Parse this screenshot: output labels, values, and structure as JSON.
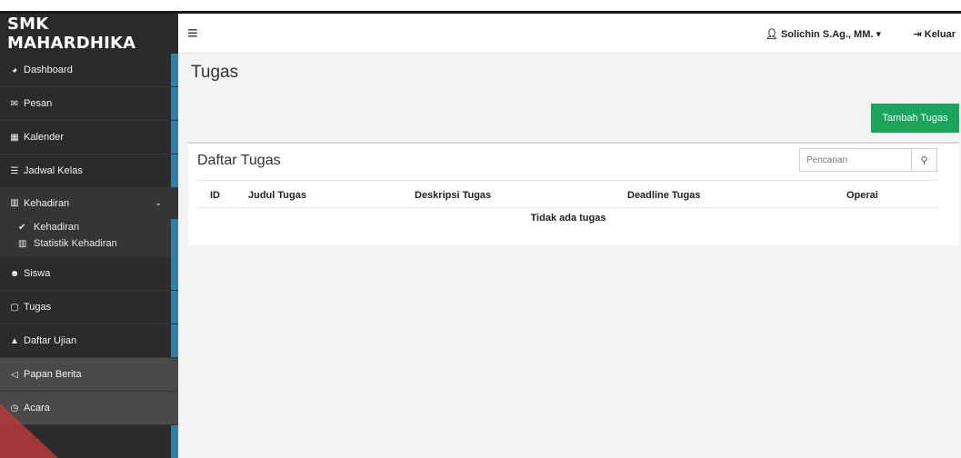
{
  "app": {
    "brand": "SMK MAHARDHIKA"
  },
  "sidebar": {
    "items": [
      {
        "label": "Dashboard",
        "icon": "dashboard-icon"
      },
      {
        "label": "Pesan",
        "icon": "envelope-icon"
      },
      {
        "label": "Kalender",
        "icon": "calendar-icon"
      },
      {
        "label": "Jadwal Kelas",
        "icon": "list-icon"
      },
      {
        "label": "Kehadiran",
        "icon": "bar-chart-icon"
      },
      {
        "label": "Siswa",
        "icon": "users-icon"
      },
      {
        "label": "Tugas",
        "icon": "file-icon"
      },
      {
        "label": "Daftar Ujian",
        "icon": "graduation-cap-icon"
      },
      {
        "label": "Papan Berita",
        "icon": "bullhorn-icon"
      },
      {
        "label": "Acara",
        "icon": "clock-icon"
      }
    ],
    "subitems": [
      {
        "label": "Kehadiran",
        "icon": "check-icon"
      },
      {
        "label": "Statistik Kehadiran",
        "icon": "bar-chart-icon"
      }
    ]
  },
  "topbar": {
    "user": "Solichin S.Ag., MM.",
    "logout": "Keluar"
  },
  "page": {
    "title": "Tugas",
    "add_button": "Tambah Tugas"
  },
  "panel": {
    "title": "Daftar Tugas",
    "search_placeholder": "Pencarian",
    "columns": [
      "ID",
      "Judul Tugas",
      "Deskripsi Tugas",
      "Deadline Tugas",
      "Operai"
    ],
    "empty_text": "Tidak ada tugas"
  },
  "colors": {
    "accent_green": "#1aa55a",
    "sidebar_bg": "#2b2b2b",
    "sidebar_stripe": "#2f7fa6"
  }
}
